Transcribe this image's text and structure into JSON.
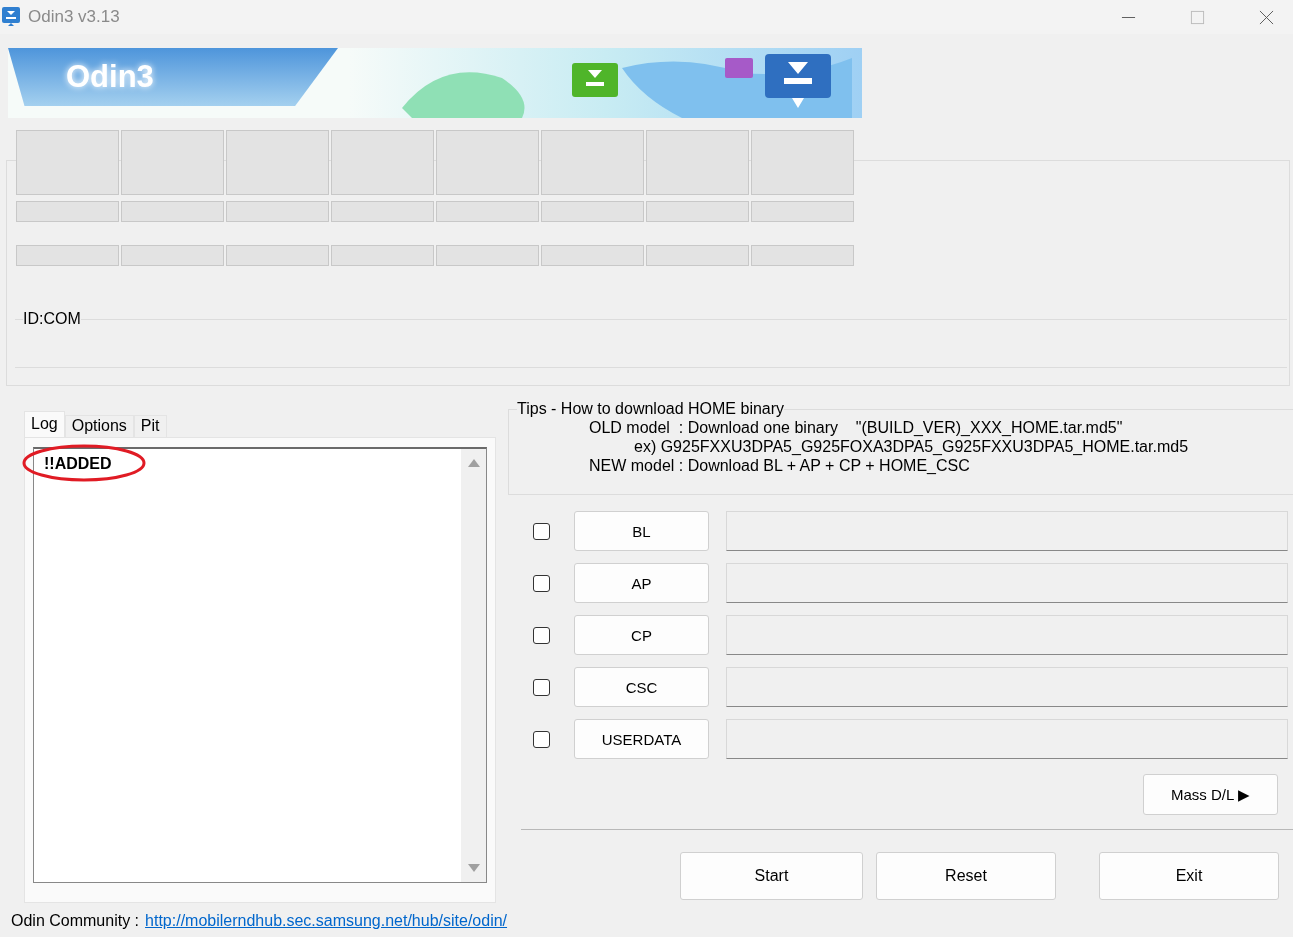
{
  "window": {
    "title": "Odin3 v3.13"
  },
  "banner": {
    "title": "Odin3"
  },
  "id_com": {
    "label": "ID:COM"
  },
  "tabs": [
    {
      "label": "Log",
      "selected": true
    },
    {
      "label": "Options",
      "selected": false
    },
    {
      "label": "Pit",
      "selected": false
    }
  ],
  "log": {
    "lines": [
      "!!ADDED"
    ]
  },
  "tips": {
    "title": "Tips - How to download HOME binary",
    "lines": [
      {
        "kind": "text",
        "text": "OLD model  : Download one binary    \"(BUILD_VER)_XXX_HOME.tar.md5\""
      },
      {
        "kind": "example",
        "text": "ex) G925FXXU3DPA5_G925FOXA3DPA5_G925FXXU3DPA5_HOME.tar.md5"
      },
      {
        "kind": "text",
        "text": "NEW model : Download BL + AP + CP + HOME_CSC"
      }
    ]
  },
  "files": [
    {
      "label": "BL",
      "checked": false
    },
    {
      "label": "AP",
      "checked": false
    },
    {
      "label": "CP",
      "checked": false
    },
    {
      "label": "CSC",
      "checked": false
    },
    {
      "label": "USERDATA",
      "checked": false
    }
  ],
  "mass_dl": "Mass D/L ▶",
  "actions": [
    "Start",
    "Reset",
    "Exit"
  ],
  "footer": {
    "label": "Odin Community :",
    "link": "http://mobilerndhub.sec.samsung.net/hub/site/odin/"
  }
}
